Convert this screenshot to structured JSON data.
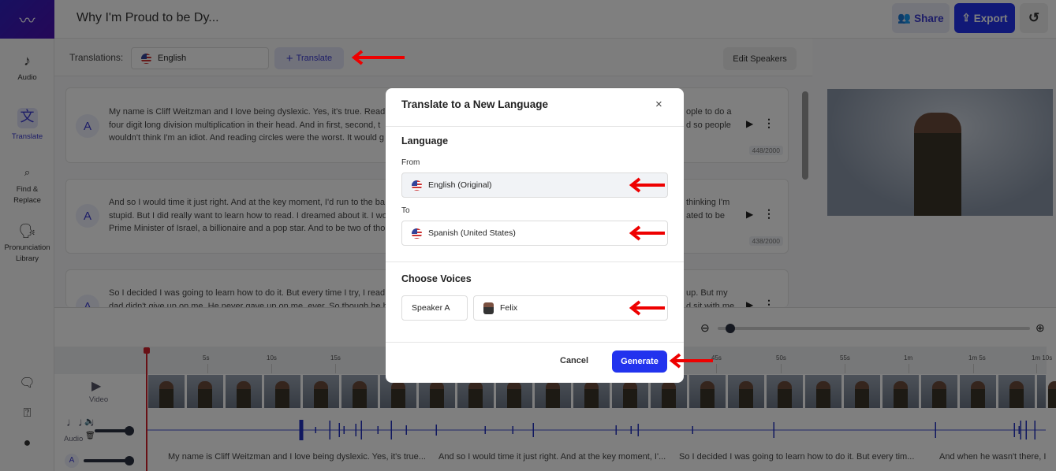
{
  "header": {
    "title": "Why I'm Proud to be Dy...",
    "share": "Share",
    "export": "Export"
  },
  "sidebar": {
    "items": [
      {
        "label": "Audio"
      },
      {
        "label": "Translate"
      },
      {
        "label": "Find &\nReplace"
      },
      {
        "label": "Pronunciation Library"
      }
    ]
  },
  "toolbar": {
    "translations_label": "Translations:",
    "language": "English",
    "translate_button": "Translate",
    "edit_speakers": "Edit Speakers"
  },
  "cards": [
    {
      "speaker": "A",
      "text_left": "My name is Cliff Weitzman and I love being dyslexic. Yes, it's true. Readi\nfour digit long division multiplication in their head. And in first, second, t\nwouldn't think I'm an idiot. And reading circles were the worst. It would g",
      "text_right": "ople to do a\nd so people",
      "count": "448/2000"
    },
    {
      "speaker": "A",
      "text_left": "And so I would time it just right. And at the key moment, I'd run to the ba\nstupid. But I did really want to learn how to read. I dreamed about it. I wo\nPrime Minister of Israel, a billionaire and a pop star. And to be two of tho",
      "text_right": "thinking I'm\nated to be",
      "count": "438/2000"
    },
    {
      "speaker": "A",
      "text_left": "So I decided I was going to learn how to do it. But every time I try, I read\ndad didn't give up on me. He never gave up on me, ever. So though he h",
      "text_right": "up. But my\nd sit with me",
      "count": ""
    }
  ],
  "timeline": {
    "ticks": [
      "5s",
      "10s",
      "15s",
      "45s",
      "50s",
      "55s",
      "1m",
      "1m 5s",
      "1m 10s"
    ],
    "tracks": {
      "video": "Video",
      "audio": "Audio",
      "caption_speaker": "A"
    },
    "captions": [
      "My name is Cliff Weitzman and I love being dyslexic. Yes, it's true...",
      "And so I would time it just right. And at the key moment, I'...",
      "So I decided I was going to learn how to do it. But every tim...",
      "And when he wasn't there, I"
    ]
  },
  "modal": {
    "title": "Translate to a New Language",
    "language_heading": "Language",
    "from_label": "From",
    "from_value": "English (Original)",
    "to_label": "To",
    "to_value": "Spanish (United States)",
    "voices_heading": "Choose Voices",
    "speaker": "Speaker A",
    "voice": "Felix",
    "cancel": "Cancel",
    "generate": "Generate"
  },
  "colors": {
    "accent": "#2233ee",
    "annotation_arrow": "#ee0000",
    "playhead": "#d0202a"
  }
}
